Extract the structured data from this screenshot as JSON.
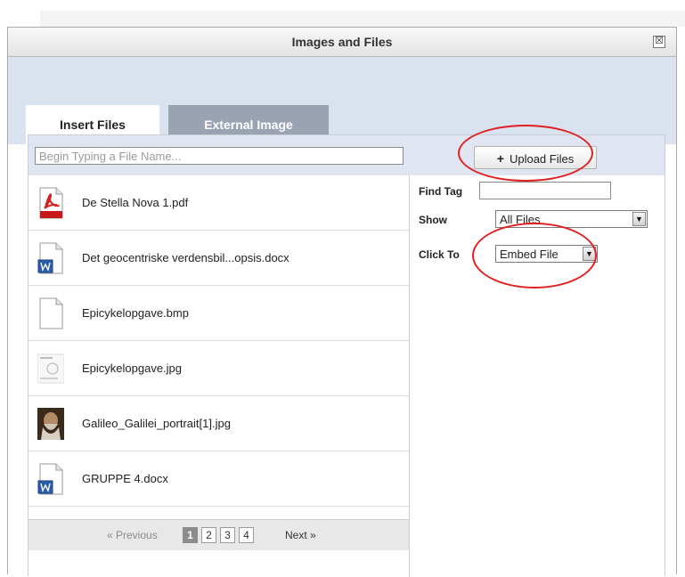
{
  "dialog": {
    "title": "Images and Files",
    "close_label": "☒"
  },
  "tabs": [
    {
      "label": "Insert Files",
      "active": true
    },
    {
      "label": "External Image",
      "active": false
    }
  ],
  "search": {
    "placeholder": "Begin Typing a File Name..."
  },
  "upload": {
    "label": "Upload Files",
    "icon": "plus-icon"
  },
  "files": [
    {
      "name": "De Stella Nova 1.pdf",
      "icon": "pdf-file-icon"
    },
    {
      "name": "Det geocentriske verdensbil...opsis.docx",
      "icon": "word-doc-icon"
    },
    {
      "name": "Epicykelopgave.bmp",
      "icon": "blank-file-icon"
    },
    {
      "name": "Epicykelopgave.jpg",
      "icon": "image-thumbnail-icon"
    },
    {
      "name": "Galileo_Galilei_portrait[1].jpg",
      "icon": "portrait-thumbnail-icon"
    },
    {
      "name": "GRUPPE 4.docx",
      "icon": "word-doc-icon"
    }
  ],
  "pagination": {
    "prev": "« Previous",
    "pages": [
      "1",
      "2",
      "3",
      "4"
    ],
    "current": "1",
    "next": "Next »"
  },
  "options": {
    "find_tag_label": "Find Tag",
    "find_tag_value": "",
    "show_label": "Show",
    "show_value": "All Files",
    "click_to_label": "Click To",
    "click_to_value": "Embed File"
  },
  "colors": {
    "annotation": "#e02020",
    "tab_strip": "#d9e2ef",
    "inactive_tab": "#9aa3b2"
  }
}
